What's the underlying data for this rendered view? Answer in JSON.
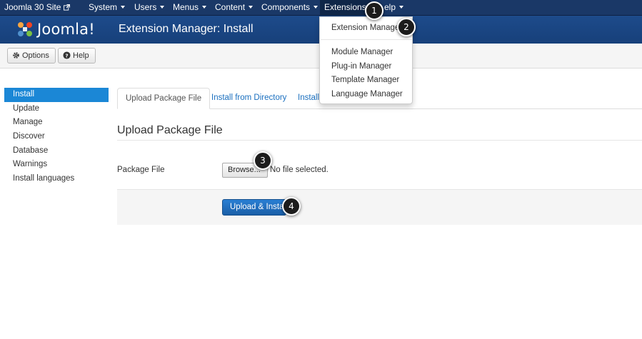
{
  "topnav": {
    "site": "Joomla 30 Site",
    "menus": [
      "System",
      "Users",
      "Menus",
      "Content",
      "Components",
      "Extensions",
      "Help"
    ],
    "help_visible": "elp"
  },
  "header": {
    "logo_text": "Joomla!",
    "title": "Extension Manager: Install"
  },
  "toolbar": {
    "options_label": "Options",
    "help_label": "Help"
  },
  "sidebar": {
    "items": [
      "Install",
      "Update",
      "Manage",
      "Discover",
      "Database",
      "Warnings",
      "Install languages"
    ]
  },
  "tabs": [
    "Upload Package File",
    "Install from Directory",
    "Install"
  ],
  "section": {
    "title": "Upload Package File",
    "field_label": "Package File",
    "browse_label": "Browse...",
    "no_file": "No file selected.",
    "upload_label": "Upload & Install"
  },
  "dropdown": {
    "items": [
      "Extension Manager",
      "Module Manager",
      "Plug-in Manager",
      "Template Manager",
      "Language Manager"
    ]
  },
  "callouts": [
    "1",
    "2",
    "3",
    "4"
  ],
  "colors": {
    "nav_bg": "#1a3867",
    "header_bg": "#1d4b8b",
    "accent": "#1b87d6",
    "upload_btn": "#2a7fd3"
  }
}
